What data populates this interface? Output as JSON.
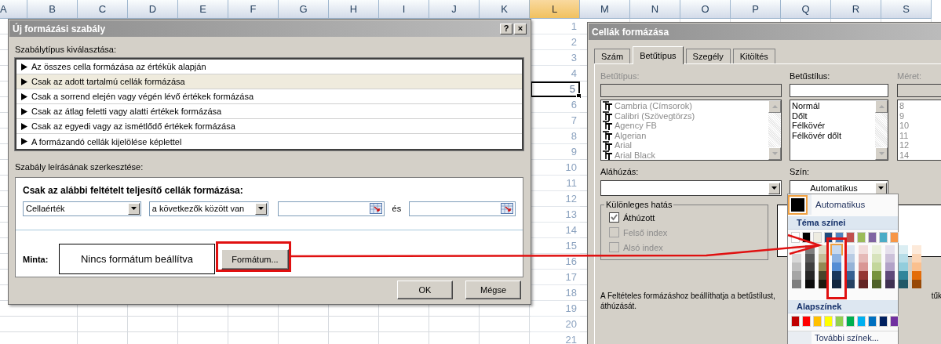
{
  "sheet": {
    "columns": [
      {
        "label": "A",
        "selected": false
      },
      {
        "label": "B",
        "selected": false
      },
      {
        "label": "C",
        "selected": false
      },
      {
        "label": "D",
        "selected": false
      },
      {
        "label": "E",
        "selected": false
      },
      {
        "label": "F",
        "selected": false
      },
      {
        "label": "G",
        "selected": false
      },
      {
        "label": "H",
        "selected": false
      },
      {
        "label": "I",
        "selected": false
      },
      {
        "label": "J",
        "selected": false
      },
      {
        "label": "K",
        "selected": false
      },
      {
        "label": "L",
        "selected": true
      },
      {
        "label": "M",
        "selected": false
      },
      {
        "label": "N",
        "selected": false
      },
      {
        "label": "O",
        "selected": false
      },
      {
        "label": "P",
        "selected": false
      },
      {
        "label": "Q",
        "selected": false
      },
      {
        "label": "R",
        "selected": false
      },
      {
        "label": "S",
        "selected": false
      }
    ],
    "rows": [
      {
        "label": "1",
        "selected": false
      },
      {
        "label": "2",
        "selected": false
      },
      {
        "label": "3",
        "selected": false
      },
      {
        "label": "4",
        "selected": false
      },
      {
        "label": "5",
        "selected": true
      },
      {
        "label": "6",
        "selected": false
      },
      {
        "label": "7",
        "selected": false
      },
      {
        "label": "8",
        "selected": false
      },
      {
        "label": "9",
        "selected": false
      },
      {
        "label": "10",
        "selected": false
      },
      {
        "label": "11",
        "selected": false
      },
      {
        "label": "12",
        "selected": false
      },
      {
        "label": "13",
        "selected": false
      },
      {
        "label": "14",
        "selected": false
      },
      {
        "label": "15",
        "selected": false
      },
      {
        "label": "16",
        "selected": false
      },
      {
        "label": "17",
        "selected": false
      },
      {
        "label": "18",
        "selected": false
      },
      {
        "label": "19",
        "selected": false
      },
      {
        "label": "20",
        "selected": false
      },
      {
        "label": "21",
        "selected": false
      }
    ]
  },
  "rule_dialog": {
    "title": "Új formázási szabály",
    "help_button": "?",
    "close_button": "×",
    "rule_type_label": "Szabálytípus kiválasztása:",
    "rule_types": [
      {
        "label": "Az összes cella formázása az értékük alapján",
        "selected": false
      },
      {
        "label": "Csak az adott tartalmú cellák formázása",
        "selected": true
      },
      {
        "label": "Csak a sorrend elején vagy végén lévő értékek formázása",
        "selected": false
      },
      {
        "label": "Csak az átlag feletti vagy alatti értékek formázása",
        "selected": false
      },
      {
        "label": "Csak az egyedi vagy az ismétlődő értékek formázása",
        "selected": false
      },
      {
        "label": "A formázandó cellák kijelölése képlettel",
        "selected": false
      }
    ],
    "description_label": "Szabály leírásának szerkesztése:",
    "condition_heading": "Csak az alábbi feltételt teljesítő cellák formázása:",
    "condition": {
      "field": "Cellaérték",
      "operator": "a következők között van",
      "joiner": "és"
    },
    "preview_label": "Minta:",
    "preview_text": "Nincs formátum beállítva",
    "format_button": "Formátum...",
    "buttons": [
      "OK",
      "Mégse"
    ]
  },
  "format_dialog": {
    "title": "Cellák formázása",
    "tabs": [
      {
        "label": "Szám",
        "selected": false
      },
      {
        "label": "Betűtípus",
        "selected": true
      },
      {
        "label": "Szegély",
        "selected": false
      },
      {
        "label": "Kitöltés",
        "selected": false
      }
    ],
    "font": {
      "label": "Betűtípus:",
      "disabled": true,
      "items": [
        "Cambria (Címsorok)",
        "Calibri (Szövegtörzs)",
        "Agency FB",
        "Algerian",
        "Arial",
        "Arial Black"
      ]
    },
    "style": {
      "label": "Betűstílus:",
      "disabled": false,
      "items": [
        "Normál",
        "Dőlt",
        "Félkövér",
        "Félkövér dőlt"
      ]
    },
    "size": {
      "label": "Méret:",
      "disabled": true,
      "items": [
        "8",
        "9",
        "10",
        "11",
        "12",
        "14"
      ]
    },
    "underline": {
      "label": "Aláhúzás:"
    },
    "color": {
      "label": "Szín:",
      "value": "Automatikus"
    },
    "effects": {
      "title": "Különleges hatás",
      "items": [
        {
          "label": "Áthúzott",
          "checked": true,
          "disabled": false
        },
        {
          "label": "Felső index",
          "checked": false,
          "disabled": true
        },
        {
          "label": "Alsó index",
          "checked": false,
          "disabled": true
        }
      ]
    },
    "note": {
      "line_1": "A Feltételes formázáshoz beállíthatja a betűstílust,",
      "line_1_end": "tűk",
      "line_2": "áthúzását."
    }
  },
  "color_palette": {
    "automatic": {
      "label": "Automatikus",
      "selected": true
    },
    "theme_heading": "Téma színei",
    "theme_colors": [
      {
        "color": "#ffffff",
        "selected": false,
        "shades": [
          {
            "color": "#f2f2f2",
            "selected": false
          },
          {
            "color": "#d8d8d8",
            "selected": false
          },
          {
            "color": "#bfbfbf",
            "selected": false
          },
          {
            "color": "#a5a5a5",
            "selected": false
          },
          {
            "color": "#7f7f7f",
            "selected": false
          }
        ]
      },
      {
        "color": "#000000",
        "selected": false,
        "shades": [
          {
            "color": "#7f7f7f",
            "selected": false
          },
          {
            "color": "#595959",
            "selected": false
          },
          {
            "color": "#3f3f3f",
            "selected": false
          },
          {
            "color": "#262626",
            "selected": false
          },
          {
            "color": "#0c0c0c",
            "selected": false
          }
        ]
      },
      {
        "color": "#eeece1",
        "selected": false,
        "shades": [
          {
            "color": "#ddd9c3",
            "selected": false
          },
          {
            "color": "#c4bd97",
            "selected": false
          },
          {
            "color": "#938953",
            "selected": false
          },
          {
            "color": "#494429",
            "selected": false
          },
          {
            "color": "#1d1b10",
            "selected": false
          }
        ]
      },
      {
        "color": "#1f497d",
        "selected": false,
        "shades": [
          {
            "color": "#c6d9f0",
            "selected": true
          },
          {
            "color": "#8db3e2",
            "selected": false
          },
          {
            "color": "#548dd4",
            "selected": false
          },
          {
            "color": "#17365d",
            "selected": false
          },
          {
            "color": "#0f243e",
            "selected": false
          }
        ]
      },
      {
        "color": "#4f81bd",
        "selected": false,
        "shades": [
          {
            "color": "#dbe5f1",
            "selected": false
          },
          {
            "color": "#b8cce4",
            "selected": false
          },
          {
            "color": "#95b3d7",
            "selected": false
          },
          {
            "color": "#366092",
            "selected": false
          },
          {
            "color": "#244061",
            "selected": false
          }
        ]
      },
      {
        "color": "#c0504d",
        "selected": false,
        "shades": [
          {
            "color": "#f2dcdb",
            "selected": false
          },
          {
            "color": "#e5b9b7",
            "selected": false
          },
          {
            "color": "#d99694",
            "selected": false
          },
          {
            "color": "#953734",
            "selected": false
          },
          {
            "color": "#632423",
            "selected": false
          }
        ]
      },
      {
        "color": "#9bbb59",
        "selected": false,
        "shades": [
          {
            "color": "#ebf1dd",
            "selected": false
          },
          {
            "color": "#d7e3bc",
            "selected": false
          },
          {
            "color": "#c3d69b",
            "selected": false
          },
          {
            "color": "#76923c",
            "selected": false
          },
          {
            "color": "#4f6128",
            "selected": false
          }
        ]
      },
      {
        "color": "#8064a2",
        "selected": false,
        "shades": [
          {
            "color": "#e5e0ec",
            "selected": false
          },
          {
            "color": "#ccc1d9",
            "selected": false
          },
          {
            "color": "#b2a2c7",
            "selected": false
          },
          {
            "color": "#5f497a",
            "selected": false
          },
          {
            "color": "#3f3151",
            "selected": false
          }
        ]
      },
      {
        "color": "#4bacc6",
        "selected": false,
        "shades": [
          {
            "color": "#dbeef3",
            "selected": false
          },
          {
            "color": "#b7dde8",
            "selected": false
          },
          {
            "color": "#92cddc",
            "selected": false
          },
          {
            "color": "#31859b",
            "selected": false
          },
          {
            "color": "#205867",
            "selected": false
          }
        ]
      },
      {
        "color": "#f79646",
        "selected": false,
        "shades": [
          {
            "color": "#fdeada",
            "selected": false
          },
          {
            "color": "#fbd5b5",
            "selected": false
          },
          {
            "color": "#fac08f",
            "selected": false
          },
          {
            "color": "#e36c09",
            "selected": false
          },
          {
            "color": "#974806",
            "selected": false
          }
        ]
      }
    ],
    "standard_heading": "Alapszínek",
    "standard_colors": [
      {
        "color": "#c00000",
        "selected": false
      },
      {
        "color": "#ff0000",
        "selected": false
      },
      {
        "color": "#ffc000",
        "selected": false
      },
      {
        "color": "#ffff00",
        "selected": false
      },
      {
        "color": "#92d050",
        "selected": false
      },
      {
        "color": "#00b050",
        "selected": false
      },
      {
        "color": "#00b0f0",
        "selected": false
      },
      {
        "color": "#0070c0",
        "selected": false
      },
      {
        "color": "#002060",
        "selected": false
      },
      {
        "color": "#7030a0",
        "selected": false
      }
    ],
    "more_colors": "További színek..."
  }
}
